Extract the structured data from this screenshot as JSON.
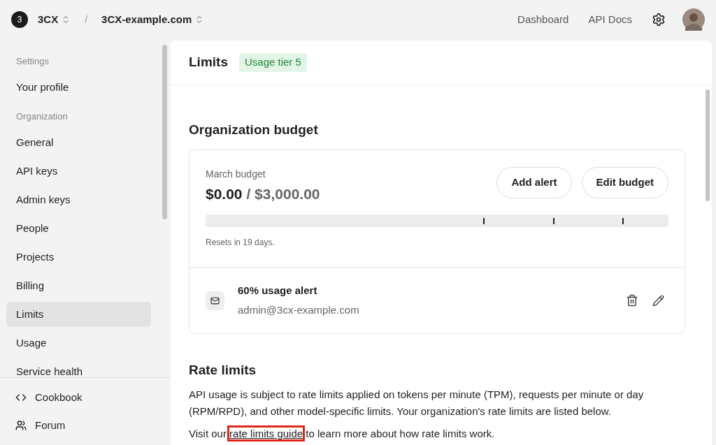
{
  "topbar": {
    "org_badge": "3",
    "org": "3CX",
    "separator": "/",
    "project": "3CX-example.com",
    "links": [
      "Dashboard",
      "API Docs"
    ]
  },
  "sidebar": {
    "sections": [
      {
        "heading": "Settings",
        "items": [
          {
            "label": "Your profile",
            "selected": false
          }
        ]
      },
      {
        "heading": "Organization",
        "items": [
          {
            "label": "General",
            "selected": false
          },
          {
            "label": "API keys",
            "selected": false
          },
          {
            "label": "Admin keys",
            "selected": false
          },
          {
            "label": "People",
            "selected": false
          },
          {
            "label": "Projects",
            "selected": false
          },
          {
            "label": "Billing",
            "selected": false
          },
          {
            "label": "Limits",
            "selected": true
          },
          {
            "label": "Usage",
            "selected": false
          },
          {
            "label": "Service health",
            "selected": false
          }
        ]
      }
    ],
    "footer": [
      {
        "kind": "code",
        "label": "Cookbook"
      },
      {
        "kind": "people",
        "label": "Forum"
      }
    ]
  },
  "page": {
    "title": "Limits",
    "badge": "Usage tier 5"
  },
  "budget": {
    "heading": "Organization budget",
    "label": "March budget",
    "spent": "$0.00",
    "separator": "/",
    "limit": "$3,000.00",
    "buttons": [
      "Add alert",
      "Edit budget"
    ],
    "level": 0,
    "markers": [
      {
        "level": 0.6
      },
      {
        "level": 0.75
      },
      {
        "level": 0.9
      }
    ],
    "note": "Resets in 19 days.",
    "alerts": [
      {
        "title": "60% usage alert",
        "email": "admin@3cx-example.com"
      }
    ]
  },
  "rate_limits": {
    "heading": "Rate limits",
    "paragraph": "API usage is subject to rate limits applied on tokens per minute (TPM), requests per minute or day (RPM/RPD), and other model-specific limits. Your organization's rate limits are listed below.",
    "visit_before": "Visit our",
    "link": "rate limits guide",
    "link_highlighted": true,
    "visit_after": "to learn more about how rate limits work."
  }
}
